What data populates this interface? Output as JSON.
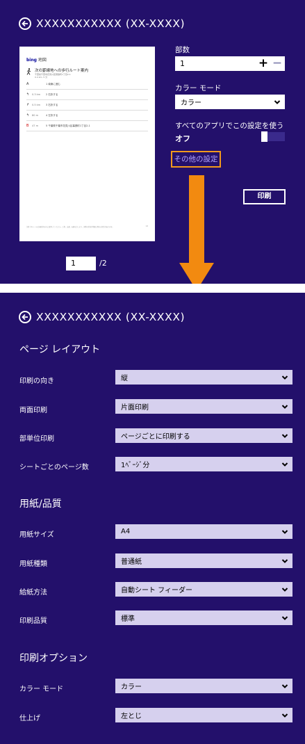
{
  "printer_name": "XXXXXXXXXXX (XX-XXXX)",
  "preview": {
    "logo_brand": "bing",
    "logo_text": "地図",
    "route_title": "次の罫線地への歩行ルート案内",
    "route_sub1": "千葉県千葉市花見川区幕張町1丁目2-1",
    "route_sub2": "0.4 km, 5 分",
    "steps": [
      {
        "icon": "A",
        "dist": "",
        "text": "1  南東に進む"
      },
      {
        "icon": "↰",
        "dist": "0.3 km",
        "text": "2  右折する"
      },
      {
        "icon": "↱",
        "dist": "0.5 km",
        "text": "3  右折する"
      },
      {
        "icon": "↰",
        "dist": "80 m",
        "text": "4  左折する"
      },
      {
        "icon": "B",
        "dist": "47 m",
        "text": "5  千葉県千葉市花見川区幕張町1丁目2-1"
      }
    ],
    "footer": "注意: 本ルートは計画目的のみに使用してください。工事、交通、天候などにより、実際の状況が地図と異なる場合があります。",
    "footer_page": "1/2"
  },
  "page_input": "1",
  "page_total": "/2",
  "copies": {
    "label": "部数",
    "value": "1",
    "plus": "+",
    "minus": "−"
  },
  "color_mode_top": {
    "label": "カラー モード",
    "value": "カラー"
  },
  "apply_all": {
    "label": "すべてのアプリでこの設定を使う",
    "state": "オフ"
  },
  "more_settings": "その他の設定",
  "print_button": "印刷",
  "layout": {
    "title": "ページ レイアウト",
    "rows": [
      {
        "label": "印刷の向き",
        "value": "縦"
      },
      {
        "label": "両面印刷",
        "value": "片面印刷"
      },
      {
        "label": "部単位印刷",
        "value": "ページごとに印刷する"
      },
      {
        "label": "シートごとのページ数",
        "value": "1ﾍﾟｰｼﾞ分"
      }
    ]
  },
  "paper": {
    "title": "用紙/品質",
    "rows": [
      {
        "label": "用紙サイズ",
        "value": "A4"
      },
      {
        "label": "用紙種類",
        "value": "普通紙"
      },
      {
        "label": "給紙方法",
        "value": "自動シート フィーダー"
      },
      {
        "label": "印刷品質",
        "value": "標準"
      }
    ]
  },
  "options": {
    "title": "印刷オプション",
    "rows": [
      {
        "label": "カラー モード",
        "value": "カラー"
      },
      {
        "label": "仕上げ",
        "value": "左とじ"
      }
    ]
  },
  "colors": {
    "panel_bg": "#23106b",
    "highlight_orange": "#f29a1c",
    "arrow_orange": "#f28a10",
    "link_color": "#b3a5ff",
    "select_bg": "#d6d0ee"
  }
}
